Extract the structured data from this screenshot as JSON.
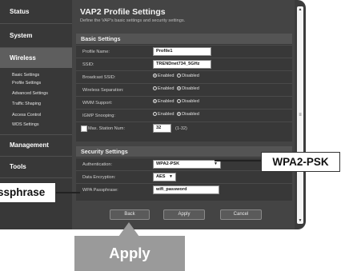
{
  "sidebar": {
    "sections": [
      {
        "label": "Status"
      },
      {
        "label": "System"
      },
      {
        "label": "Wireless"
      },
      {
        "label": "Management"
      },
      {
        "label": "Tools"
      }
    ],
    "wireless_items": [
      {
        "label": "Basic Settings"
      },
      {
        "label": "Profile Settings"
      },
      {
        "label": "Advanced Settings"
      },
      {
        "label": "Traffic Shaping"
      },
      {
        "label": "Access Control"
      },
      {
        "label": "WDS Settings"
      }
    ]
  },
  "page": {
    "title": "VAP2 Profile Settings",
    "description": "Define the VAP's basic settings and security settings."
  },
  "basic": {
    "header": "Basic Settings",
    "profile_name_label": "Profile Name:",
    "profile_name_value": "Profile1",
    "ssid_label": "SSID:",
    "ssid_value": "TRENDnet734_5GHz",
    "broadcast_label": "Broadcast SSID:",
    "broadcast_opt1": "Enabled",
    "broadcast_opt2": "Disabled",
    "separation_label": "Wireless Separation:",
    "separation_opt1": "Enabled",
    "separation_opt2": "Disabled",
    "wmm_label": "WMM Support:",
    "wmm_opt1": "Enabled",
    "wmm_opt2": "Disabled",
    "igmp_label": "IGMP Snooping:",
    "igmp_opt1": "Enabled",
    "igmp_opt2": "Disabled",
    "max_station_label": "Max. Station Num:",
    "max_station_value": "32",
    "max_station_range": "(1-32)"
  },
  "security": {
    "header": "Security Settings",
    "auth_label": "Authentication:",
    "auth_value": "WPA2-PSK",
    "encryption_label": "Data Encryption:",
    "encryption_value": "AES",
    "passphrase_label": "WPA Passphrase:",
    "passphrase_value": "wifi_password"
  },
  "buttons": {
    "back": "Back",
    "apply": "Apply",
    "cancel": "Cancel"
  },
  "callouts": {
    "wpa2": "WPA2-PSK",
    "passphrase": "ssphrase",
    "apply": "Apply"
  },
  "icons": {
    "scroll_up": "triangle-up",
    "scroll_down": "triangle-down",
    "dropdown": "triangle-down"
  }
}
